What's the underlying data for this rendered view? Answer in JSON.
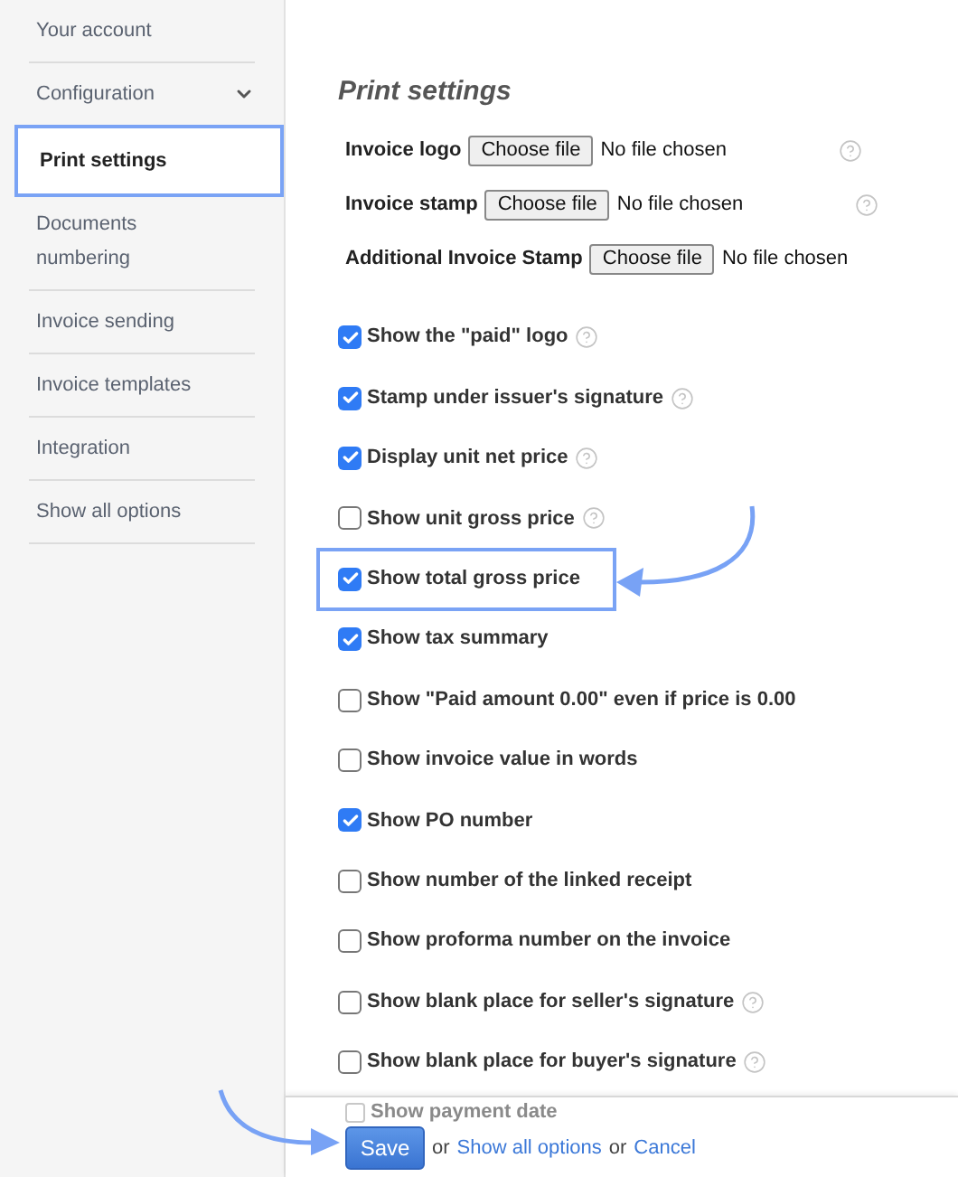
{
  "sidebar": {
    "items": [
      {
        "label": "Your account",
        "selected": false,
        "has_submenu": false
      },
      {
        "label": "Configuration",
        "selected": false,
        "has_submenu": true
      },
      {
        "label": "Print settings",
        "selected": true,
        "has_submenu": false
      },
      {
        "label": "Documents numbering",
        "selected": false,
        "has_submenu": false
      },
      {
        "label": "Invoice sending",
        "selected": false,
        "has_submenu": false
      },
      {
        "label": "Invoice templates",
        "selected": false,
        "has_submenu": false
      },
      {
        "label": "Integration",
        "selected": false,
        "has_submenu": false
      },
      {
        "label": "Show all options",
        "selected": false,
        "has_submenu": false
      }
    ]
  },
  "title": "Print settings",
  "file_fields": [
    {
      "label": "Invoice logo",
      "button": "Choose file",
      "status": "No file chosen",
      "help": true
    },
    {
      "label": "Invoice stamp",
      "button": "Choose file",
      "status": "No file chosen",
      "help": true
    },
    {
      "label": "Additional Invoice Stamp",
      "button": "Choose file",
      "status": "No file chosen",
      "help": false
    }
  ],
  "options": [
    {
      "label": "Show the \"paid\" logo",
      "checked": true,
      "help": true,
      "highlighted": false
    },
    {
      "label": "Stamp under issuer's signature",
      "checked": true,
      "help": true,
      "highlighted": false
    },
    {
      "label": "Display unit net price",
      "checked": true,
      "help": true,
      "highlighted": false
    },
    {
      "label": "Show unit gross price",
      "checked": false,
      "help": true,
      "highlighted": false
    },
    {
      "label": "Show total gross price",
      "checked": true,
      "help": false,
      "highlighted": true
    },
    {
      "label": "Show tax summary",
      "checked": true,
      "help": false,
      "highlighted": false
    },
    {
      "label": "Show \"Paid amount 0.00\" even if price is 0.00",
      "checked": false,
      "help": false,
      "highlighted": false
    },
    {
      "label": "Show invoice value in words",
      "checked": false,
      "help": false,
      "highlighted": false
    },
    {
      "label": "Show PO number",
      "checked": true,
      "help": false,
      "highlighted": false
    },
    {
      "label": "Show number of the linked receipt",
      "checked": false,
      "help": false,
      "highlighted": false
    },
    {
      "label": "Show proforma number on the invoice",
      "checked": false,
      "help": false,
      "highlighted": false
    },
    {
      "label": "Show blank place for seller's signature",
      "checked": false,
      "help": true,
      "highlighted": false
    },
    {
      "label": "Show blank place for buyer's signature",
      "checked": false,
      "help": true,
      "highlighted": false
    }
  ],
  "footer": {
    "faded_option": "Show payment date",
    "faded_checked": false,
    "save": "Save",
    "or_1": "or",
    "show_all": "Show all options",
    "or_2": "or",
    "cancel": "Cancel"
  }
}
